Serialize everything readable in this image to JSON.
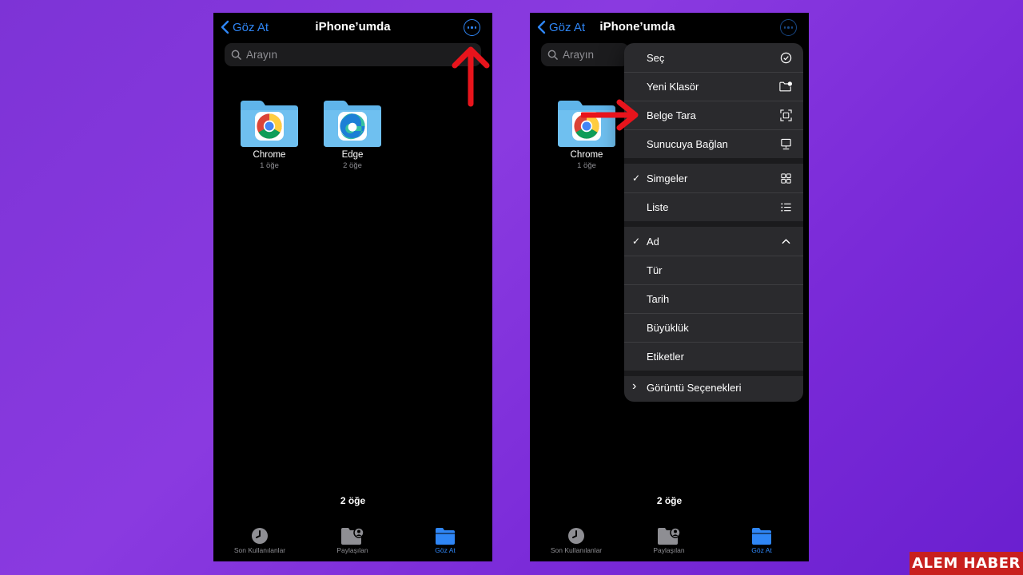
{
  "colors": {
    "accent": "#2f86f6",
    "arrow": "#e8141c",
    "folder": "#5fb4ea",
    "watermark_bg": "#c8201e"
  },
  "left_phone": {
    "nav": {
      "back_label": "Göz At",
      "title": "iPhone’umda",
      "more_icon": "ellipsis-circle-icon"
    },
    "search": {
      "placeholder": "Arayın"
    },
    "folders": [
      {
        "name": "Chrome",
        "count": "1 öğe",
        "app_icon": "chrome-icon"
      },
      {
        "name": "Edge",
        "count": "2 öğe",
        "app_icon": "edge-icon"
      }
    ],
    "item_count": "2 öğe",
    "tabs": [
      {
        "label": "Son Kullanılanlar",
        "icon": "clock-icon",
        "active": false
      },
      {
        "label": "Paylaşılan",
        "icon": "shared-folder-icon",
        "active": false
      },
      {
        "label": "Göz At",
        "icon": "folder-icon",
        "active": true
      }
    ]
  },
  "right_phone": {
    "nav": {
      "back_label": "Göz At",
      "title": "iPhone’umda"
    },
    "search": {
      "placeholder": "Arayın"
    },
    "folders": [
      {
        "name": "Chrome",
        "count": "1 öğe"
      }
    ],
    "item_count": "2 öğe",
    "tabs": [
      {
        "label": "Son Kullanılanlar"
      },
      {
        "label": "Paylaşılan"
      },
      {
        "label": "Göz At"
      }
    ],
    "menu": {
      "actions": [
        {
          "label": "Seç",
          "icon": "checkmark-circle-icon"
        },
        {
          "label": "Yeni Klasör",
          "icon": "folder-badge-plus-icon"
        },
        {
          "label": "Belge Tara",
          "icon": "doc-scanner-icon"
        },
        {
          "label": "Sunucuya Bağlan",
          "icon": "server-display-icon"
        }
      ],
      "view": [
        {
          "label": "Simgeler",
          "icon": "grid-icon",
          "checked": true
        },
        {
          "label": "Liste",
          "icon": "list-icon",
          "checked": false
        }
      ],
      "sort": [
        {
          "label": "Ad",
          "icon": "chevron-up-icon",
          "checked": true
        },
        {
          "label": "Tür"
        },
        {
          "label": "Tarih"
        },
        {
          "label": "Büyüklük"
        },
        {
          "label": "Etiketler"
        }
      ],
      "view_options_label": "Görüntü Seçenekleri",
      "check_mark": "✓",
      "disclosure_mark": "›"
    }
  },
  "watermark": "ALEM HABER"
}
